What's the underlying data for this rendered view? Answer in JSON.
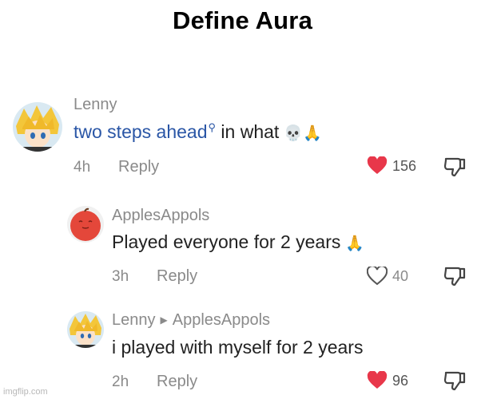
{
  "caption": "Define Aura",
  "comments": [
    {
      "username": "Lenny",
      "text_link": "two steps ahead",
      "text_rest": " in what",
      "emoji": "💀🙏",
      "time": "4h",
      "reply_label": "Reply",
      "likes": "156",
      "liked": true
    },
    {
      "username": "ApplesAppols",
      "text": "Played everyone for 2 years",
      "emoji": "🙏",
      "time": "3h",
      "reply_label": "Reply",
      "likes": "40",
      "liked": false
    },
    {
      "username": "Lenny",
      "reply_to": "ApplesAppols",
      "text": "i played with myself for 2 years",
      "time": "2h",
      "reply_label": "Reply",
      "likes": "96",
      "liked": true
    }
  ],
  "watermark": "imgflip.com",
  "colors": {
    "heart": "#e8374a",
    "link": "#2a56a6",
    "meta": "#8a8a8a"
  }
}
